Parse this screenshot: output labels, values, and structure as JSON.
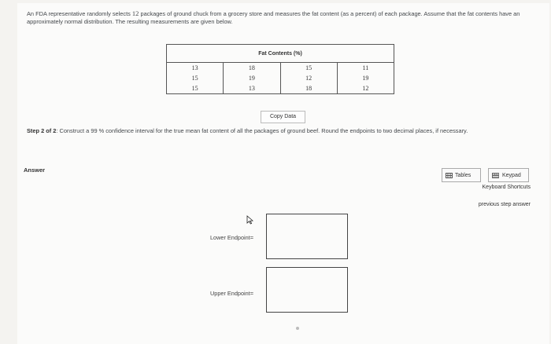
{
  "problem": {
    "text_before": "An FDA representative randomly selects ",
    "n": "12",
    "text_after": " packages of ground chuck from a grocery store and measures the fat content (as a percent) of each package. Assume that the fat contents have an approximately normal distribution. The resulting measurements are given below."
  },
  "table": {
    "header": "Fat Contents (%)",
    "rows": [
      [
        "13",
        "18",
        "15",
        "11"
      ],
      [
        "15",
        "19",
        "12",
        "19"
      ],
      [
        "15",
        "13",
        "18",
        "12"
      ]
    ]
  },
  "copy_button": "Copy Data",
  "step": {
    "label": "Step 2 of 2",
    "text_a": ": Construct a ",
    "level": "99",
    "text_b": " % confidence interval for the true mean fat content of all the packages of ground beef. Round the endpoints to two decimal places, if necessary."
  },
  "answer_label": "Answer",
  "tools": {
    "tables": "Tables",
    "keypad": "Keypad",
    "keyboard_shortcuts": "Keyboard Shortcuts",
    "previous_step": "previous step answer"
  },
  "fields": {
    "lower_label": "Lower Endpoint=",
    "lower_value": "",
    "upper_label": "Upper Endpoint=",
    "upper_value": ""
  },
  "icons": [
    "table-icon",
    "keypad-icon",
    "mouse-cursor-icon"
  ]
}
